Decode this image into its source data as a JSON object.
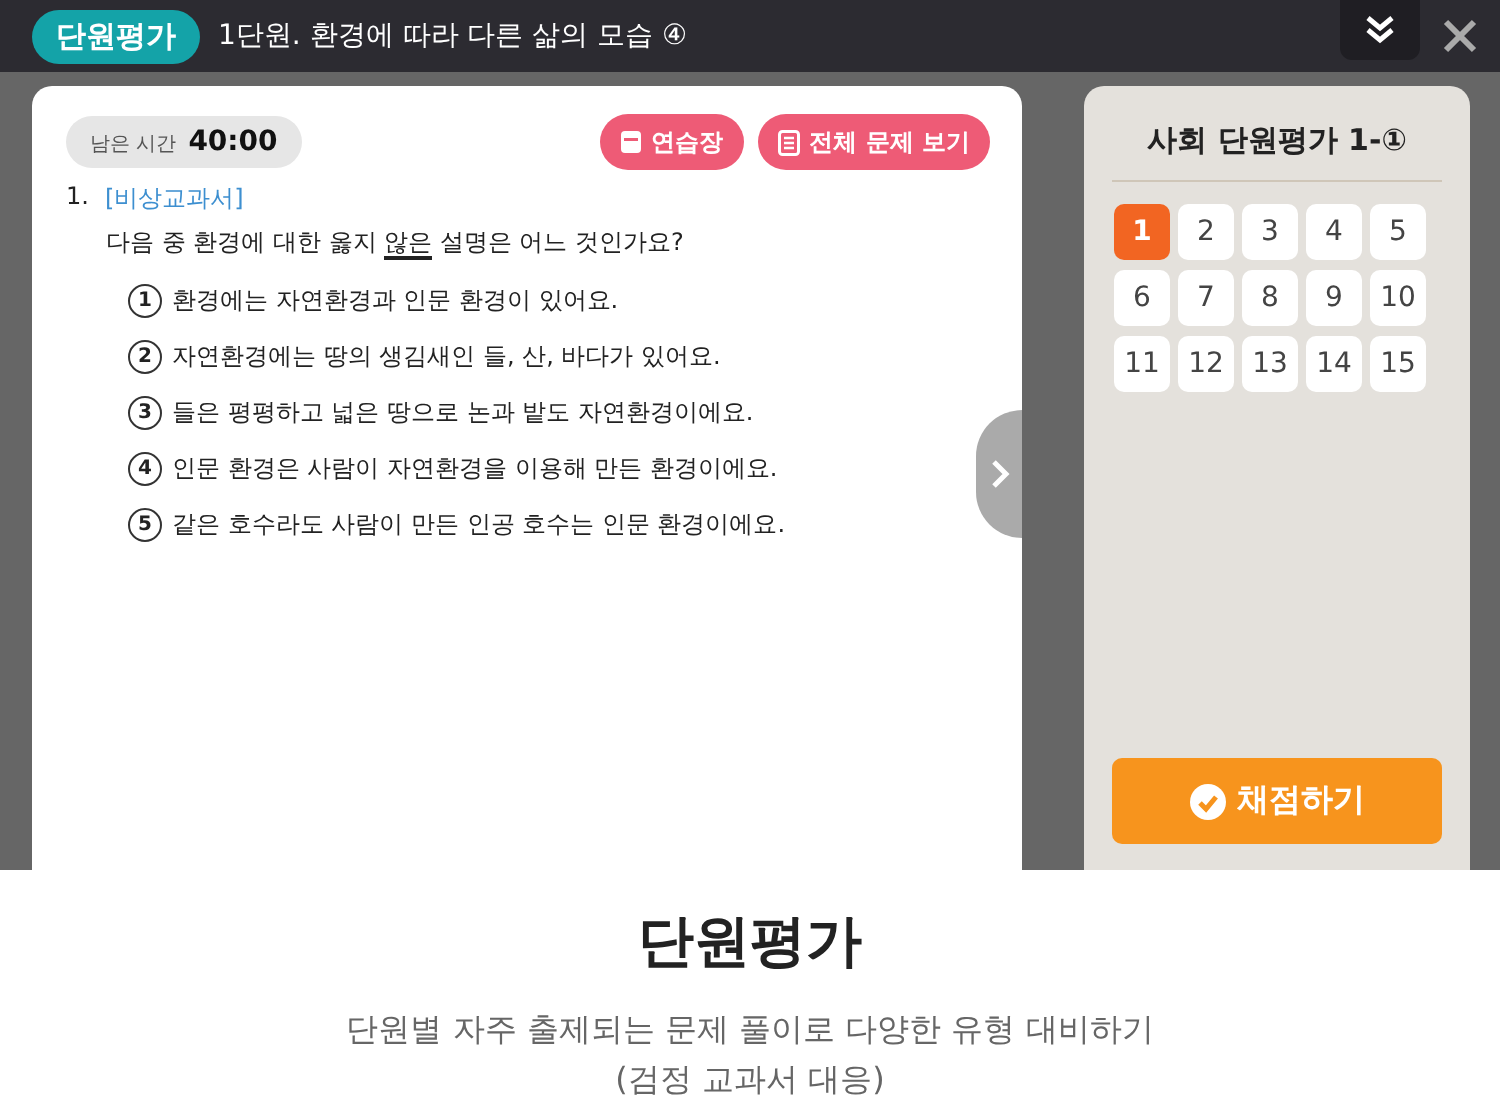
{
  "header": {
    "badge": "단원평가",
    "title": "1단원. 환경에 따라 다른 삶의 모습 ④"
  },
  "quiz": {
    "timer_label": "남은 시간",
    "timer_value": "40:00",
    "buttons": [
      {
        "kind": "notebook",
        "label": "연습장"
      },
      {
        "kind": "list",
        "label": "전체 문제 보기"
      }
    ],
    "question": {
      "number": "1.",
      "source": "[비상교과서]",
      "before": "다음 중 환경에 대한 옳지 ",
      "underlined": "않은",
      "after": " 설명은 어느 것인가요?"
    },
    "choices": [
      {
        "number": "1",
        "text": "환경에는 자연환경과 인문 환경이 있어요."
      },
      {
        "number": "2",
        "text": "자연환경에는 땅의 생김새인 들, 산, 바다가 있어요."
      },
      {
        "number": "3",
        "text": "들은 평평하고 넓은 땅으로 논과 밭도 자연환경이에요."
      },
      {
        "number": "4",
        "text": "인문 환경은 사람이 자연환경을 이용해 만든 환경이에요."
      },
      {
        "number": "5",
        "text": "같은 호수라도 사람이 만든 인공 호수는 인문 환경이에요."
      }
    ]
  },
  "panel": {
    "title": "사회 단원평가 1-①",
    "questions": [
      {
        "label": "1",
        "selected": true
      },
      {
        "label": "2",
        "selected": false
      },
      {
        "label": "3",
        "selected": false
      },
      {
        "label": "4",
        "selected": false
      },
      {
        "label": "5",
        "selected": false
      },
      {
        "label": "6",
        "selected": false
      },
      {
        "label": "7",
        "selected": false
      },
      {
        "label": "8",
        "selected": false
      },
      {
        "label": "9",
        "selected": false
      },
      {
        "label": "10",
        "selected": false
      },
      {
        "label": "11",
        "selected": false
      },
      {
        "label": "12",
        "selected": false
      },
      {
        "label": "13",
        "selected": false
      },
      {
        "label": "14",
        "selected": false
      },
      {
        "label": "15",
        "selected": false
      }
    ],
    "submit": "채점하기"
  },
  "caption": {
    "title": "단원평가",
    "lines": [
      "단원별 자주 출제되는 문제 풀이로 다양한 유형 대비하기",
      "(검정 교과서 대응)"
    ]
  }
}
